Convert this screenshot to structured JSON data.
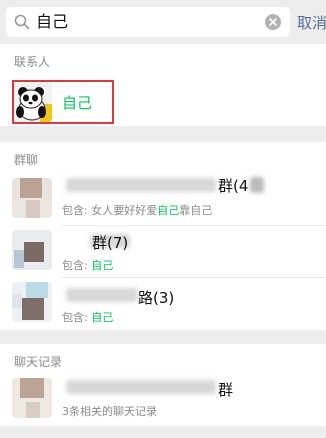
{
  "search": {
    "query": "自己",
    "cancel_label": "取消"
  },
  "contacts": {
    "header": "联系人",
    "items": [
      {
        "name": "自己",
        "avatar": "panda-avatar-icon"
      }
    ]
  },
  "groups": {
    "header": "群聊",
    "items": [
      {
        "name_suffix": "群(4",
        "contains_prefix": "包含: 女人要好好爱",
        "contains_highlight": "自己",
        "contains_suffix": "靠自己"
      },
      {
        "name_suffix": "群(7)",
        "contains_prefix": "包含: ",
        "contains_highlight": "自己",
        "contains_suffix": ""
      },
      {
        "name_suffix": "路(3)",
        "contains_prefix": "包含: ",
        "contains_highlight": "自己",
        "contains_suffix": ""
      }
    ]
  },
  "chat_history": {
    "header": "聊天记录",
    "items": [
      {
        "name_suffix": "群",
        "summary": "3条相关的聊天记录"
      }
    ]
  },
  "colors": {
    "highlight": "#07c160",
    "cancel": "#576b95",
    "annotation": "#d93a3a"
  }
}
